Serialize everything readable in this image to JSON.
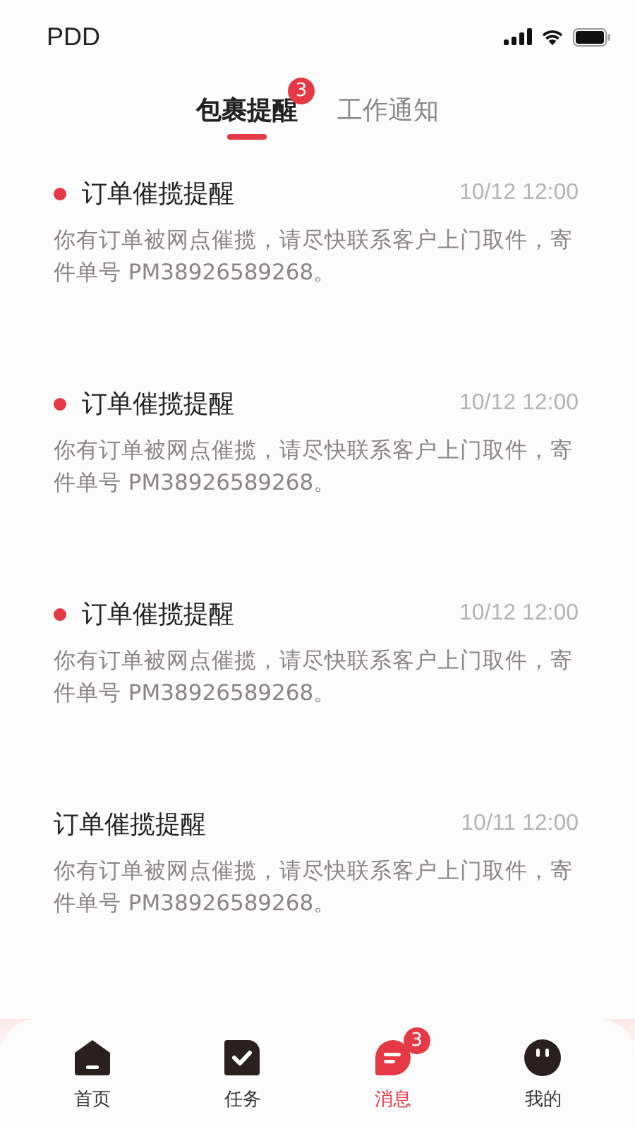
{
  "status_bar": {
    "carrier": "PDD"
  },
  "tabs": [
    {
      "label": "包裹提醒",
      "selected": true,
      "badge": "3"
    },
    {
      "label": "工作通知",
      "selected": false
    }
  ],
  "messages": [
    {
      "title": "订单催揽提醒",
      "time": "10/12 12:00",
      "unread": true,
      "body": "你有订单被网点催揽，请尽快联系客户上门取件，寄件单号 PM38926589268。"
    },
    {
      "title": "订单催揽提醒",
      "time": "10/12 12:00",
      "unread": true,
      "body": "你有订单被网点催揽，请尽快联系客户上门取件，寄件单号 PM38926589268。"
    },
    {
      "title": "订单催揽提醒",
      "time": "10/12 12:00",
      "unread": true,
      "body": "你有订单被网点催揽，请尽快联系客户上门取件，寄件单号 PM38926589268。"
    },
    {
      "title": "订单催揽提醒",
      "time": "10/11 12:00",
      "unread": false,
      "body": "你有订单被网点催揽，请尽快联系客户上门取件，寄件单号 PM38926589268。"
    }
  ],
  "nav": [
    {
      "kind": "home",
      "label": "首页",
      "selected": false
    },
    {
      "kind": "tasks",
      "label": "任务",
      "selected": false
    },
    {
      "kind": "messages",
      "label": "消息",
      "selected": true,
      "badge": "3"
    },
    {
      "kind": "profile",
      "label": "我的",
      "selected": false
    }
  ]
}
